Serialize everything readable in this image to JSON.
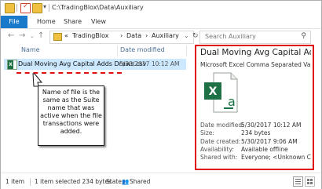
{
  "window": {
    "path": "C:\\TradingBlox\\Data\\Auxiliary"
  },
  "ribbon": {
    "tabs": [
      "File",
      "Home",
      "Share",
      "View"
    ]
  },
  "address": {
    "prefix": "«",
    "crumbs": [
      "TradingBlox",
      "Data",
      "Auxiliary"
    ]
  },
  "search": {
    "placeholder": "Search Auxiliary"
  },
  "list": {
    "columns": [
      "Name",
      "Date modified"
    ],
    "files": [
      {
        "name": "Dual Moving Avg Capital Adds Draws.csv",
        "date_modified": "5/30/2017 10:12 AM"
      }
    ]
  },
  "annotation": "Name of file is the same as the Suite name that was active when the file transactions were added.",
  "details": {
    "title": "Dual Moving Avg Capital Adds ...",
    "type": "Microsoft Excel Comma Separated Values...",
    "properties": [
      {
        "label": "Date modified:",
        "value": "5/30/2017 10:12 AM"
      },
      {
        "label": "Size:",
        "value": "234 bytes"
      },
      {
        "label": "Date created:",
        "value": "5/30/2017 9:06 AM"
      },
      {
        "label": "Availability:",
        "value": "Available offline"
      },
      {
        "label": "Shared with:",
        "value": "Everyone; <Unknown C..."
      }
    ]
  },
  "status": {
    "count": "1 item",
    "selection": "1 item selected 234 bytes",
    "state_label": "State:",
    "state_value": "Shared"
  },
  "colors": {
    "accent": "#1979ca",
    "selection": "#cce8ff",
    "highlight": "#e01010",
    "excel": "#1e7145"
  }
}
